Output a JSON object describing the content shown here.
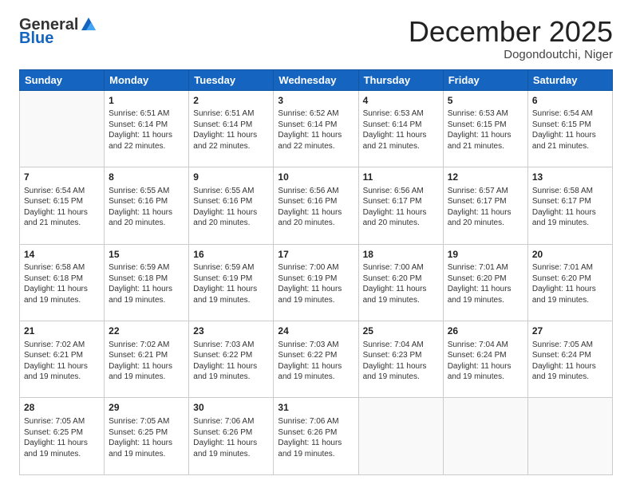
{
  "logo": {
    "general": "General",
    "blue": "Blue"
  },
  "header": {
    "title": "December 2025",
    "subtitle": "Dogondoutchi, Niger"
  },
  "weekdays": [
    "Sunday",
    "Monday",
    "Tuesday",
    "Wednesday",
    "Thursday",
    "Friday",
    "Saturday"
  ],
  "weeks": [
    [
      {
        "day": "",
        "info": ""
      },
      {
        "day": "1",
        "info": "Sunrise: 6:51 AM\nSunset: 6:14 PM\nDaylight: 11 hours\nand 22 minutes."
      },
      {
        "day": "2",
        "info": "Sunrise: 6:51 AM\nSunset: 6:14 PM\nDaylight: 11 hours\nand 22 minutes."
      },
      {
        "day": "3",
        "info": "Sunrise: 6:52 AM\nSunset: 6:14 PM\nDaylight: 11 hours\nand 22 minutes."
      },
      {
        "day": "4",
        "info": "Sunrise: 6:53 AM\nSunset: 6:14 PM\nDaylight: 11 hours\nand 21 minutes."
      },
      {
        "day": "5",
        "info": "Sunrise: 6:53 AM\nSunset: 6:15 PM\nDaylight: 11 hours\nand 21 minutes."
      },
      {
        "day": "6",
        "info": "Sunrise: 6:54 AM\nSunset: 6:15 PM\nDaylight: 11 hours\nand 21 minutes."
      }
    ],
    [
      {
        "day": "7",
        "info": "Sunrise: 6:54 AM\nSunset: 6:15 PM\nDaylight: 11 hours\nand 21 minutes."
      },
      {
        "day": "8",
        "info": "Sunrise: 6:55 AM\nSunset: 6:16 PM\nDaylight: 11 hours\nand 20 minutes."
      },
      {
        "day": "9",
        "info": "Sunrise: 6:55 AM\nSunset: 6:16 PM\nDaylight: 11 hours\nand 20 minutes."
      },
      {
        "day": "10",
        "info": "Sunrise: 6:56 AM\nSunset: 6:16 PM\nDaylight: 11 hours\nand 20 minutes."
      },
      {
        "day": "11",
        "info": "Sunrise: 6:56 AM\nSunset: 6:17 PM\nDaylight: 11 hours\nand 20 minutes."
      },
      {
        "day": "12",
        "info": "Sunrise: 6:57 AM\nSunset: 6:17 PM\nDaylight: 11 hours\nand 20 minutes."
      },
      {
        "day": "13",
        "info": "Sunrise: 6:58 AM\nSunset: 6:17 PM\nDaylight: 11 hours\nand 19 minutes."
      }
    ],
    [
      {
        "day": "14",
        "info": "Sunrise: 6:58 AM\nSunset: 6:18 PM\nDaylight: 11 hours\nand 19 minutes."
      },
      {
        "day": "15",
        "info": "Sunrise: 6:59 AM\nSunset: 6:18 PM\nDaylight: 11 hours\nand 19 minutes."
      },
      {
        "day": "16",
        "info": "Sunrise: 6:59 AM\nSunset: 6:19 PM\nDaylight: 11 hours\nand 19 minutes."
      },
      {
        "day": "17",
        "info": "Sunrise: 7:00 AM\nSunset: 6:19 PM\nDaylight: 11 hours\nand 19 minutes."
      },
      {
        "day": "18",
        "info": "Sunrise: 7:00 AM\nSunset: 6:20 PM\nDaylight: 11 hours\nand 19 minutes."
      },
      {
        "day": "19",
        "info": "Sunrise: 7:01 AM\nSunset: 6:20 PM\nDaylight: 11 hours\nand 19 minutes."
      },
      {
        "day": "20",
        "info": "Sunrise: 7:01 AM\nSunset: 6:20 PM\nDaylight: 11 hours\nand 19 minutes."
      }
    ],
    [
      {
        "day": "21",
        "info": "Sunrise: 7:02 AM\nSunset: 6:21 PM\nDaylight: 11 hours\nand 19 minutes."
      },
      {
        "day": "22",
        "info": "Sunrise: 7:02 AM\nSunset: 6:21 PM\nDaylight: 11 hours\nand 19 minutes."
      },
      {
        "day": "23",
        "info": "Sunrise: 7:03 AM\nSunset: 6:22 PM\nDaylight: 11 hours\nand 19 minutes."
      },
      {
        "day": "24",
        "info": "Sunrise: 7:03 AM\nSunset: 6:22 PM\nDaylight: 11 hours\nand 19 minutes."
      },
      {
        "day": "25",
        "info": "Sunrise: 7:04 AM\nSunset: 6:23 PM\nDaylight: 11 hours\nand 19 minutes."
      },
      {
        "day": "26",
        "info": "Sunrise: 7:04 AM\nSunset: 6:24 PM\nDaylight: 11 hours\nand 19 minutes."
      },
      {
        "day": "27",
        "info": "Sunrise: 7:05 AM\nSunset: 6:24 PM\nDaylight: 11 hours\nand 19 minutes."
      }
    ],
    [
      {
        "day": "28",
        "info": "Sunrise: 7:05 AM\nSunset: 6:25 PM\nDaylight: 11 hours\nand 19 minutes."
      },
      {
        "day": "29",
        "info": "Sunrise: 7:05 AM\nSunset: 6:25 PM\nDaylight: 11 hours\nand 19 minutes."
      },
      {
        "day": "30",
        "info": "Sunrise: 7:06 AM\nSunset: 6:26 PM\nDaylight: 11 hours\nand 19 minutes."
      },
      {
        "day": "31",
        "info": "Sunrise: 7:06 AM\nSunset: 6:26 PM\nDaylight: 11 hours\nand 19 minutes."
      },
      {
        "day": "",
        "info": ""
      },
      {
        "day": "",
        "info": ""
      },
      {
        "day": "",
        "info": ""
      }
    ]
  ]
}
